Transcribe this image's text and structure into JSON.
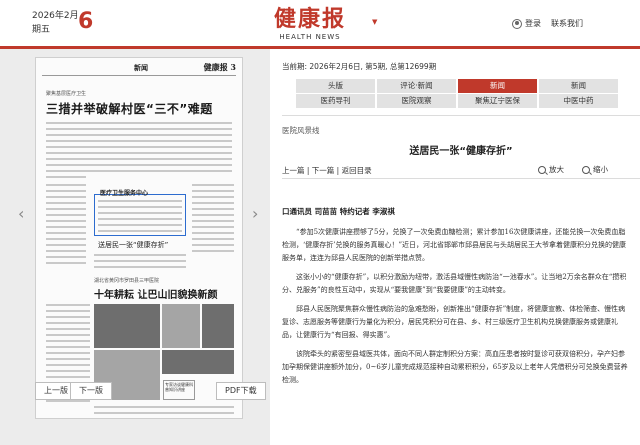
{
  "header": {
    "year_month": "2026年2月",
    "day_label": "星期",
    "day": "6",
    "weekday": "期五",
    "logo_cn": "健康报",
    "logo_en": "HEALTH NEWS",
    "login": "登录",
    "contact": "联系我们"
  },
  "thumbnail": {
    "section": "新闻",
    "page_logo": "健康报 3",
    "kicker": "聚焦基层医疗卫生",
    "headline": "三措并举破解村医“三不”难题",
    "highlight_title": "医疗卫生服务中心",
    "highlight_sub": "送居民一张“健康存折”",
    "kicker2": "湖北省黄冈市罗田县三甲医院",
    "headline2": "十年耕耘  让巴山旧貌换新颜",
    "box_text": "专家访谈健康科普知识讲座"
  },
  "nav": {
    "prev_arrow": "‹",
    "next_arrow": "›",
    "prev_page": "上一版",
    "next_page": "下一版",
    "pdf": "PDF下载"
  },
  "issue": {
    "info": "当前期: 2026年2月6日, 第5期, 总第12699期"
  },
  "sections": [
    [
      "头版",
      "评论·新闻",
      "新闻",
      "新闻"
    ],
    [
      "医药导刊",
      "医院观察",
      "聚焦辽宁医保",
      "中医中药"
    ]
  ],
  "active_section": "新闻",
  "article": {
    "column": "医院风景线",
    "title": "送居民一张“健康存折”",
    "nav_prev": "上一篇",
    "nav_next": "下一篇",
    "nav_back": "返回目录",
    "zoom_in": "放大",
    "zoom_out": "缩小",
    "byline": "口通讯员  司苗苗  特约记者  李淑祺",
    "paragraphs": [
      "“参加5次健康讲座攒够了5分，兑换了一次免费血糖检测；累计参加16次健康讲座，还能兑换一次免费血脂检测，‘健康存折’兑换的服务真暖心！”近日，河北省邯郸市邱县居民与头胡居民王大爷拿着健康积分兑换的健康服务单，连连为邱县人民医院的创新举措点赞。",
      "这张小小的“健康存折”，以积分激励为纽带，激活县域慢性病防治“一池春水”。让当地2万余名群众在“攒积分、兑服务”的良性互动中，实现从“要我健康”到“我要健康”的主动转变。",
      "邱县人民医院聚焦群众慢性病防治的急难愁盼，创新推出“健康存折”制度，将健康宣教、体检筛查、慢性病复诊、志愿服务等健康行为量化为积分，居民凭积分可在县、乡、村三级医疗卫生机构兑换健康服务或健康礼品，让健康行为“有回报、得实惠”。",
      "该院牵头的紧密型县域医共体，面向不同人群定制积分方案：高血压患者按时复诊可获双倍积分，孕产妇参加孕期保健讲座额外加分，0~6岁儿童完成规范接种自动累积积分，65岁及以上老年人凭借积分可兑换免费营养检测。"
    ]
  }
}
